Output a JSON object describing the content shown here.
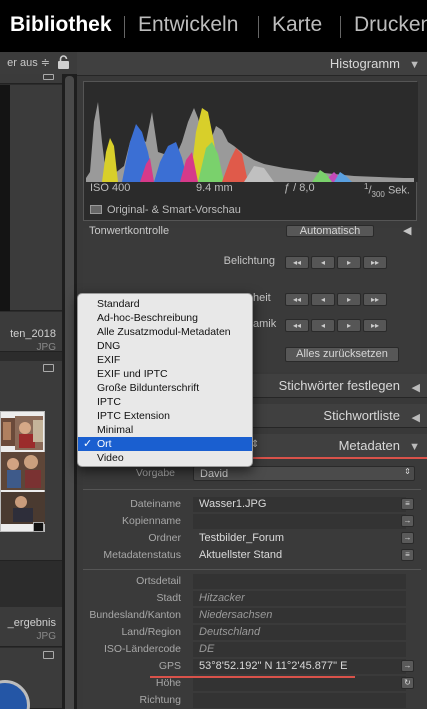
{
  "modules": [
    "Bibliothek",
    "Entwickeln",
    "Karte",
    "Drucken"
  ],
  "left": {
    "filter_label": "er aus ≑",
    "items": [
      {
        "name": "ten_2018",
        "type": "JPG"
      },
      {
        "name": "_ergebnis",
        "type": "JPG"
      }
    ]
  },
  "histogram": {
    "title": "Histogramm",
    "iso": "ISO 400",
    "focal": "9.4 mm",
    "aperture": "ƒ / 8,0",
    "shutter_num": "1",
    "shutter_den": "300",
    "shutter_unit": "Sek.",
    "preview_label": "Original- & Smart-Vorschau"
  },
  "quick_develop": {
    "tonwert_label": "Tonwertkontrolle",
    "auto_button": "Automatisch",
    "exposure_label": "Belichtung",
    "contrast_label_suffix": "heit",
    "vibrance_label_suffix": "amik",
    "reset_button": "Alles zurücksetzen",
    "btn_double_left": "◂◂",
    "btn_left": "◂",
    "btn_right": "▸",
    "btn_double_right": "▸▸"
  },
  "panels": {
    "keywording": "Stichwörter festlegen",
    "keyword_list": "Stichwortliste",
    "metadata": "Metadaten"
  },
  "metadata": {
    "preset_label": "Vorgabe",
    "preset_value": "David",
    "fields": [
      {
        "key": "Dateiname",
        "value": "Wasser1.JPG",
        "style": "normal"
      },
      {
        "key": "Kopienname",
        "value": "",
        "style": "normal"
      },
      {
        "key": "Ordner",
        "value": "Testbilder_Forum",
        "style": "plain"
      },
      {
        "key": "Metadatenstatus",
        "value": "Aktuellster Stand",
        "style": "plain"
      }
    ],
    "location_fields": [
      {
        "key": "Ortsdetail",
        "value": "",
        "style": "normal"
      },
      {
        "key": "Stadt",
        "value": "Hitzacker",
        "style": "italic"
      },
      {
        "key": "Bundesland/Kanton",
        "value": "Niedersachsen",
        "style": "italic"
      },
      {
        "key": "Land/Region",
        "value": "Deutschland",
        "style": "italic"
      },
      {
        "key": "ISO-Ländercode",
        "value": "DE",
        "style": "italic"
      },
      {
        "key": "GPS",
        "value": "53°8'52.192\" N 11°2'45.877\" E",
        "style": "normal"
      },
      {
        "key": "Höhe",
        "value": "",
        "style": "normal"
      },
      {
        "key": "Richtung",
        "value": "",
        "style": "normal"
      }
    ]
  },
  "preset_menu": {
    "items": [
      "Standard",
      "Ad-hoc-Beschreibung",
      "Alle Zusatzmodul-Metadaten",
      "DNG",
      "EXIF",
      "EXIF und IPTC",
      "Große Bildunterschrift",
      "IPTC",
      "IPTC Extension",
      "Minimal",
      "Ort",
      "Video"
    ],
    "selected": "Ort",
    "check": "✓"
  },
  "colors": {
    "accent_red": "#d9524a",
    "menu_highlight": "#1a5fd0"
  }
}
